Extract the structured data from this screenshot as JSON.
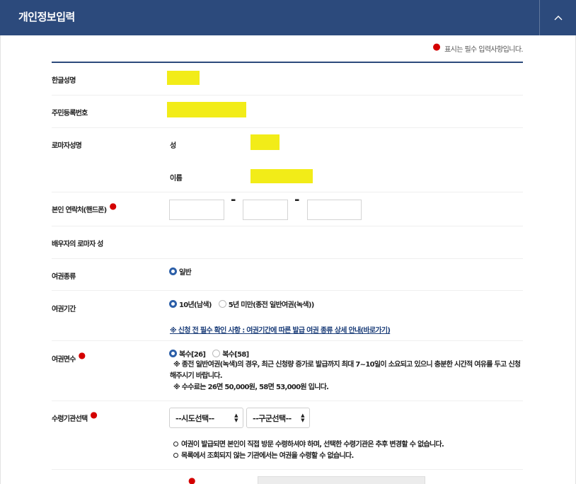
{
  "header": {
    "title": "개인정보입력"
  },
  "required_note": "표시는 필수 입력사항입니다.",
  "fields": {
    "korean_name": {
      "label": "한글성명"
    },
    "resident_number": {
      "label": "주민등록번호"
    },
    "roman_name": {
      "label": "로마자성명",
      "surname_label": "성",
      "given_label": "이름"
    },
    "phone": {
      "label": "본인 연락처(핸드폰)",
      "dash": "-"
    },
    "spouse_roman": {
      "label": "배우자의 로마자 성"
    },
    "passport_type": {
      "label": "여권종류",
      "options": [
        "일반"
      ],
      "selected": "일반"
    },
    "passport_period": {
      "label": "여권기간",
      "options": [
        "10년(남색)",
        "5년 미만(종전 일반여권(녹색))"
      ],
      "selected": "10년(남색)",
      "link": "※ 신청 전 필수 확인 사항 : 여권기간에 따른 발급 여권 종류 상세 안내(바로가기)"
    },
    "pages": {
      "label": "여권면수",
      "options": [
        "복수[26]",
        "복수[58]"
      ],
      "selected": "복수[26]",
      "note1": "※ 종전 일반여권(녹색)의 경우, 최근 신청량 증가로 발급까지 최대 7~10일이 소요되고 있으니 충분한 시간적 여유를 두고 신청해주시기 바랍니다.",
      "note2": "※ 수수료는 26면 50,000원, 58면 53,000원 입니다."
    },
    "pickup": {
      "label": "수령기관선택",
      "sido_select": "--시도선택--",
      "gugun_select": "--구군선택--",
      "bullet1": "여권이 발급되면 본인이 직접 방문 수령하셔야 하며, 선택한 수령기관은 추후 변경할 수 없습니다.",
      "bullet2": "목록에서 조회되지 않는 기관에서는 여권을 수령할 수 없습니다."
    }
  },
  "colors": {
    "header_bg": "#2c4a7c",
    "highlight": "#f2ec18",
    "required": "#d40000",
    "radio_on": "#2c5fa8"
  }
}
